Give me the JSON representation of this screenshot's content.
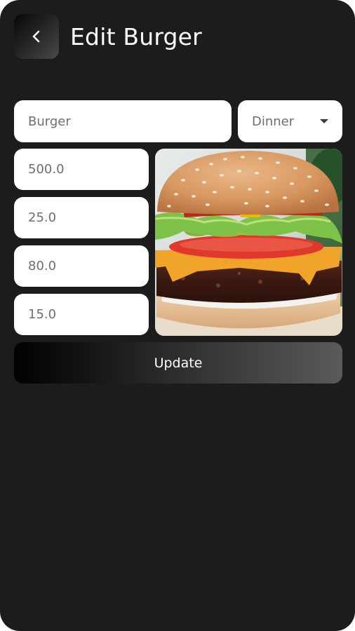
{
  "header": {
    "back_icon": "chevron-left-icon",
    "title": "Edit Burger"
  },
  "form": {
    "name_value": "Burger",
    "category": {
      "selected": "Dinner",
      "icon": "dropdown-caret-icon"
    },
    "fields": [
      {
        "value": "500.0"
      },
      {
        "value": "25.0"
      },
      {
        "value": "80.0"
      },
      {
        "value": "15.0"
      }
    ],
    "update_label": "Update"
  },
  "colors": {
    "background": "#1c1c1c",
    "field_background": "#ffffff",
    "field_text": "#6f6f6f",
    "title_text": "#ffffff"
  }
}
